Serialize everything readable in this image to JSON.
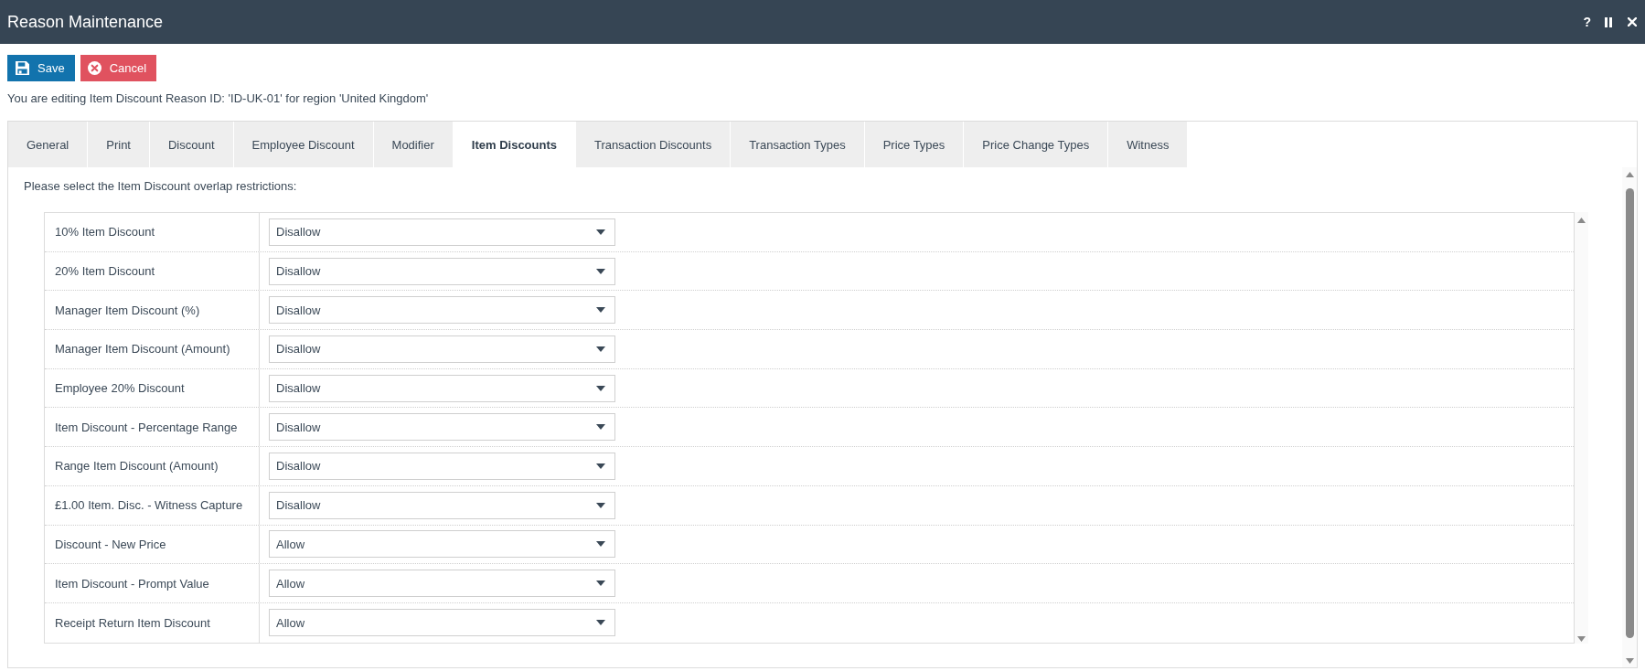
{
  "window": {
    "title": "Reason Maintenance",
    "help": "?"
  },
  "toolbar": [
    {
      "kind": "save",
      "label": "Save"
    },
    {
      "kind": "cancel",
      "label": "Cancel"
    }
  ],
  "info": "You are editing Item Discount Reason ID: 'ID-UK-01' for region 'United Kingdom'",
  "tabs": [
    {
      "label": "General",
      "selected": false
    },
    {
      "label": "Print",
      "selected": false
    },
    {
      "label": "Discount",
      "selected": false
    },
    {
      "label": "Employee Discount",
      "selected": false
    },
    {
      "label": "Modifier",
      "selected": false
    },
    {
      "label": "Item Discounts",
      "selected": true
    },
    {
      "label": "Transaction Discounts",
      "selected": false
    },
    {
      "label": "Transaction Types",
      "selected": false
    },
    {
      "label": "Price Types",
      "selected": false
    },
    {
      "label": "Price Change Types",
      "selected": false
    },
    {
      "label": "Witness",
      "selected": false
    }
  ],
  "instruction": "Please select the Item Discount overlap restrictions:",
  "restrictions": [
    {
      "label": "10% Item Discount",
      "value": "Disallow"
    },
    {
      "label": "20% Item Discount",
      "value": "Disallow"
    },
    {
      "label": "Manager Item Discount (%)",
      "value": "Disallow"
    },
    {
      "label": "Manager Item Discount (Amount)",
      "value": "Disallow"
    },
    {
      "label": "Employee 20% Discount",
      "value": "Disallow"
    },
    {
      "label": "Item Discount - Percentage Range",
      "value": "Disallow"
    },
    {
      "label": "Range Item Discount (Amount)",
      "value": "Disallow"
    },
    {
      "label": "£1.00 Item. Disc. - Witness Capture",
      "value": "Disallow"
    },
    {
      "label": "Discount - New Price",
      "value": "Allow"
    },
    {
      "label": "Item Discount - Prompt Value",
      "value": "Allow"
    },
    {
      "label": "Receipt Return Item Discount",
      "value": "Allow"
    }
  ]
}
